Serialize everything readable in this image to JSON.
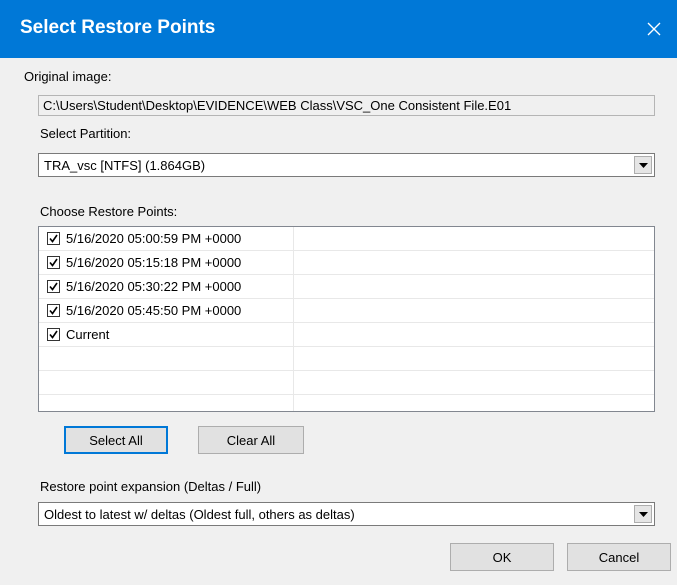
{
  "window": {
    "title": "Select Restore Points"
  },
  "original_image": {
    "label": "Original image:",
    "value": "C:\\Users\\Student\\Desktop\\EVIDENCE\\WEB Class\\VSC_One Consistent File.E01"
  },
  "partition": {
    "label": "Select Partition:",
    "selected": "TRA_vsc [NTFS] (1.864GB)"
  },
  "restore_points": {
    "label": "Choose Restore Points:",
    "items": [
      {
        "label": "5/16/2020 05:00:59 PM +0000",
        "checked": true
      },
      {
        "label": "5/16/2020 05:15:18 PM +0000",
        "checked": true
      },
      {
        "label": "5/16/2020 05:30:22 PM +0000",
        "checked": true
      },
      {
        "label": "5/16/2020 05:45:50 PM +0000",
        "checked": true
      },
      {
        "label": "Current",
        "checked": true
      }
    ]
  },
  "buttons": {
    "select_all": "Select All",
    "clear_all": "Clear All",
    "ok": "OK",
    "cancel": "Cancel"
  },
  "expansion": {
    "label": "Restore point expansion (Deltas / Full)",
    "selected": "Oldest to latest w/ deltas (Oldest full, others as deltas)"
  },
  "colors": {
    "titlebar": "#0078d7",
    "dialog_bg": "#f0f0f0"
  }
}
